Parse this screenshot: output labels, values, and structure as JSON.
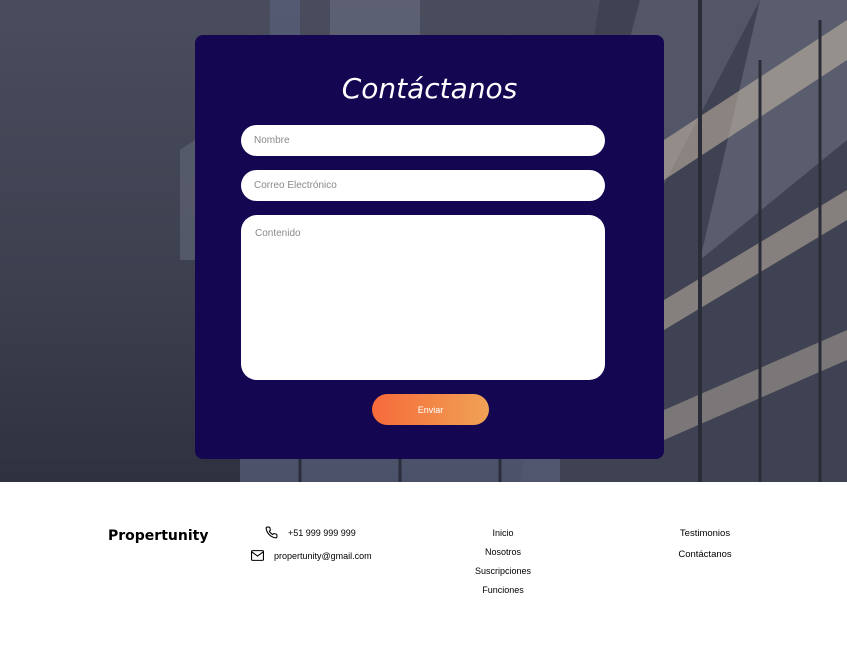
{
  "contact_form": {
    "title": "Contáctanos",
    "name_placeholder": "Nombre",
    "email_placeholder": "Correo Electrónico",
    "content_placeholder": "Contenido",
    "submit_label": "Enviar"
  },
  "footer": {
    "brand": "Propertunity",
    "phone": "+51 999 999 999",
    "email": "propertunity@gmail.com",
    "links_col1": [
      "Inicio",
      "Nosotros",
      "Suscripciones",
      "Funciones"
    ],
    "links_col2": [
      "Testimonios",
      "Contáctanos"
    ]
  },
  "colors": {
    "card_bg": "#150652",
    "button_gradient_start": "#f66a3a",
    "button_gradient_end": "#efa255"
  }
}
